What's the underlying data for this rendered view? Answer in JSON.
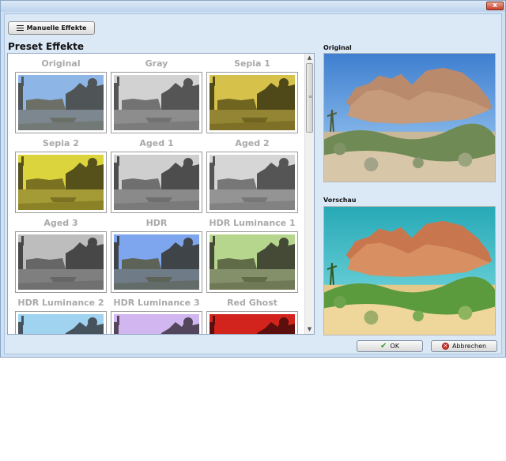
{
  "window": {
    "close_label": "x"
  },
  "toolbar": {
    "manual_effects_label": "Manuelle Effekte"
  },
  "presets": {
    "title": "Preset Effekte",
    "items": [
      {
        "label": "Original",
        "sky": "#8db6e6",
        "ground": "#6c6f66",
        "build": "#4f5456",
        "water": "#7c8790"
      },
      {
        "label": "Gray",
        "sky": "#d2d2d2",
        "ground": "#727272",
        "build": "#555555",
        "water": "#8d8d8d"
      },
      {
        "label": "Sepia 1",
        "sky": "#d6c24a",
        "ground": "#6f6420",
        "build": "#4f4818",
        "water": "#938533"
      },
      {
        "label": "Sepia 2",
        "sky": "#dcd43c",
        "ground": "#7a7220",
        "build": "#56501a",
        "water": "#a59b36"
      },
      {
        "label": "Aged 1",
        "sky": "#cfcfcf",
        "ground": "#6f6f6f",
        "build": "#4d4d4d",
        "water": "#8a8a8a"
      },
      {
        "label": "Aged 2",
        "sky": "#d6d6d6",
        "ground": "#777777",
        "build": "#555555",
        "water": "#949494"
      },
      {
        "label": "Aged 3",
        "sky": "#bdbdbd",
        "ground": "#666666",
        "build": "#474747",
        "water": "#7f7f7f"
      },
      {
        "label": "HDR",
        "sky": "#7da6ee",
        "ground": "#5d6356",
        "build": "#3f4448",
        "water": "#6f7c88"
      },
      {
        "label": "HDR Luminance 1",
        "sky": "#b6d68e",
        "ground": "#606b48",
        "build": "#444a36",
        "water": "#84906a"
      },
      {
        "label": "HDR Luminance 2",
        "sky": "#9fd3ef",
        "ground": "#5f6e78",
        "build": "#46535c",
        "water": "#7f9aa6"
      },
      {
        "label": "HDR Luminance 3",
        "sky": "#d2b6ef",
        "ground": "#6e6078",
        "build": "#53465c",
        "water": "#9a86a6"
      },
      {
        "label": "Red Ghost",
        "sky": "#d2241c",
        "ground": "#7a1410",
        "build": "#5c0f0c",
        "water": "#a61c16"
      }
    ]
  },
  "original": {
    "label": "Original"
  },
  "preview": {
    "label": "Vorschau"
  },
  "buttons": {
    "ok_label": "OK",
    "cancel_label": "Abbrechen"
  },
  "colors": {
    "accent_ok": "#2f9e2f",
    "accent_cancel": "#d8322a",
    "client_bg": "#dbe8f6"
  }
}
